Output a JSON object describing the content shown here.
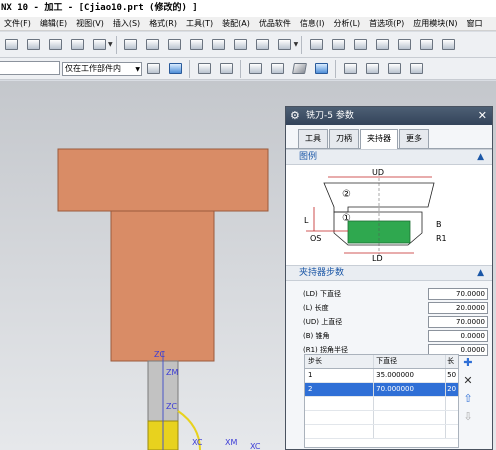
{
  "window_title": "NX 10 - 加工 - [Cjiao10.prt (修改的) ]",
  "menu": [
    "文件(F)",
    "编辑(E)",
    "视图(V)",
    "插入(S)",
    "格式(R)",
    "工具(T)",
    "装配(A)",
    "优品软件",
    "信息(I)",
    "分析(L)",
    "首选项(P)",
    "应用模块(N)",
    "窗口"
  ],
  "selection_filter": {
    "value": "仅在工作部件内"
  },
  "viewport": {
    "labels": {
      "zc": "ZC",
      "zm": "ZM",
      "zc2": "ZC",
      "xc": "XC",
      "xm": "XM",
      "xc2": "XC"
    }
  },
  "dialog": {
    "title": "铣刀-5 参数",
    "tabs": [
      "工具",
      "刀柄",
      "夹持器",
      "更多"
    ],
    "active_tab": "夹持器",
    "diagram_section": "图例",
    "diagram_labels": {
      "ud": "UD",
      "ld": "LD",
      "l": "L",
      "os": "OS",
      "b": "B",
      "r1": "R1",
      "n1": "①",
      "n2": "②"
    },
    "steps_section": "夹持器步数",
    "params": [
      {
        "label": "(LD) 下直径",
        "value": "70.0000"
      },
      {
        "label": "(L) 长度",
        "value": "20.0000"
      },
      {
        "label": "(UD) 上直径",
        "value": "70.0000"
      },
      {
        "label": "(B) 锥角",
        "value": "0.0000"
      },
      {
        "label": "(R1) 拐角半径",
        "value": "0.0000"
      }
    ],
    "table": {
      "headers": [
        "步长",
        "下直径",
        "长"
      ],
      "rows": [
        {
          "step": "1",
          "diameter": "35.000000",
          "length": "50"
        },
        {
          "step": "2",
          "diameter": "70.000000",
          "length": "20"
        }
      ],
      "selected_row": 2
    }
  },
  "colors": {
    "holder": "#d98c66",
    "tool_shank": "#c2c2c2",
    "tool_flute": "#e8d21e",
    "accent": "#1b57a7",
    "selection": "#2f6fd6"
  }
}
